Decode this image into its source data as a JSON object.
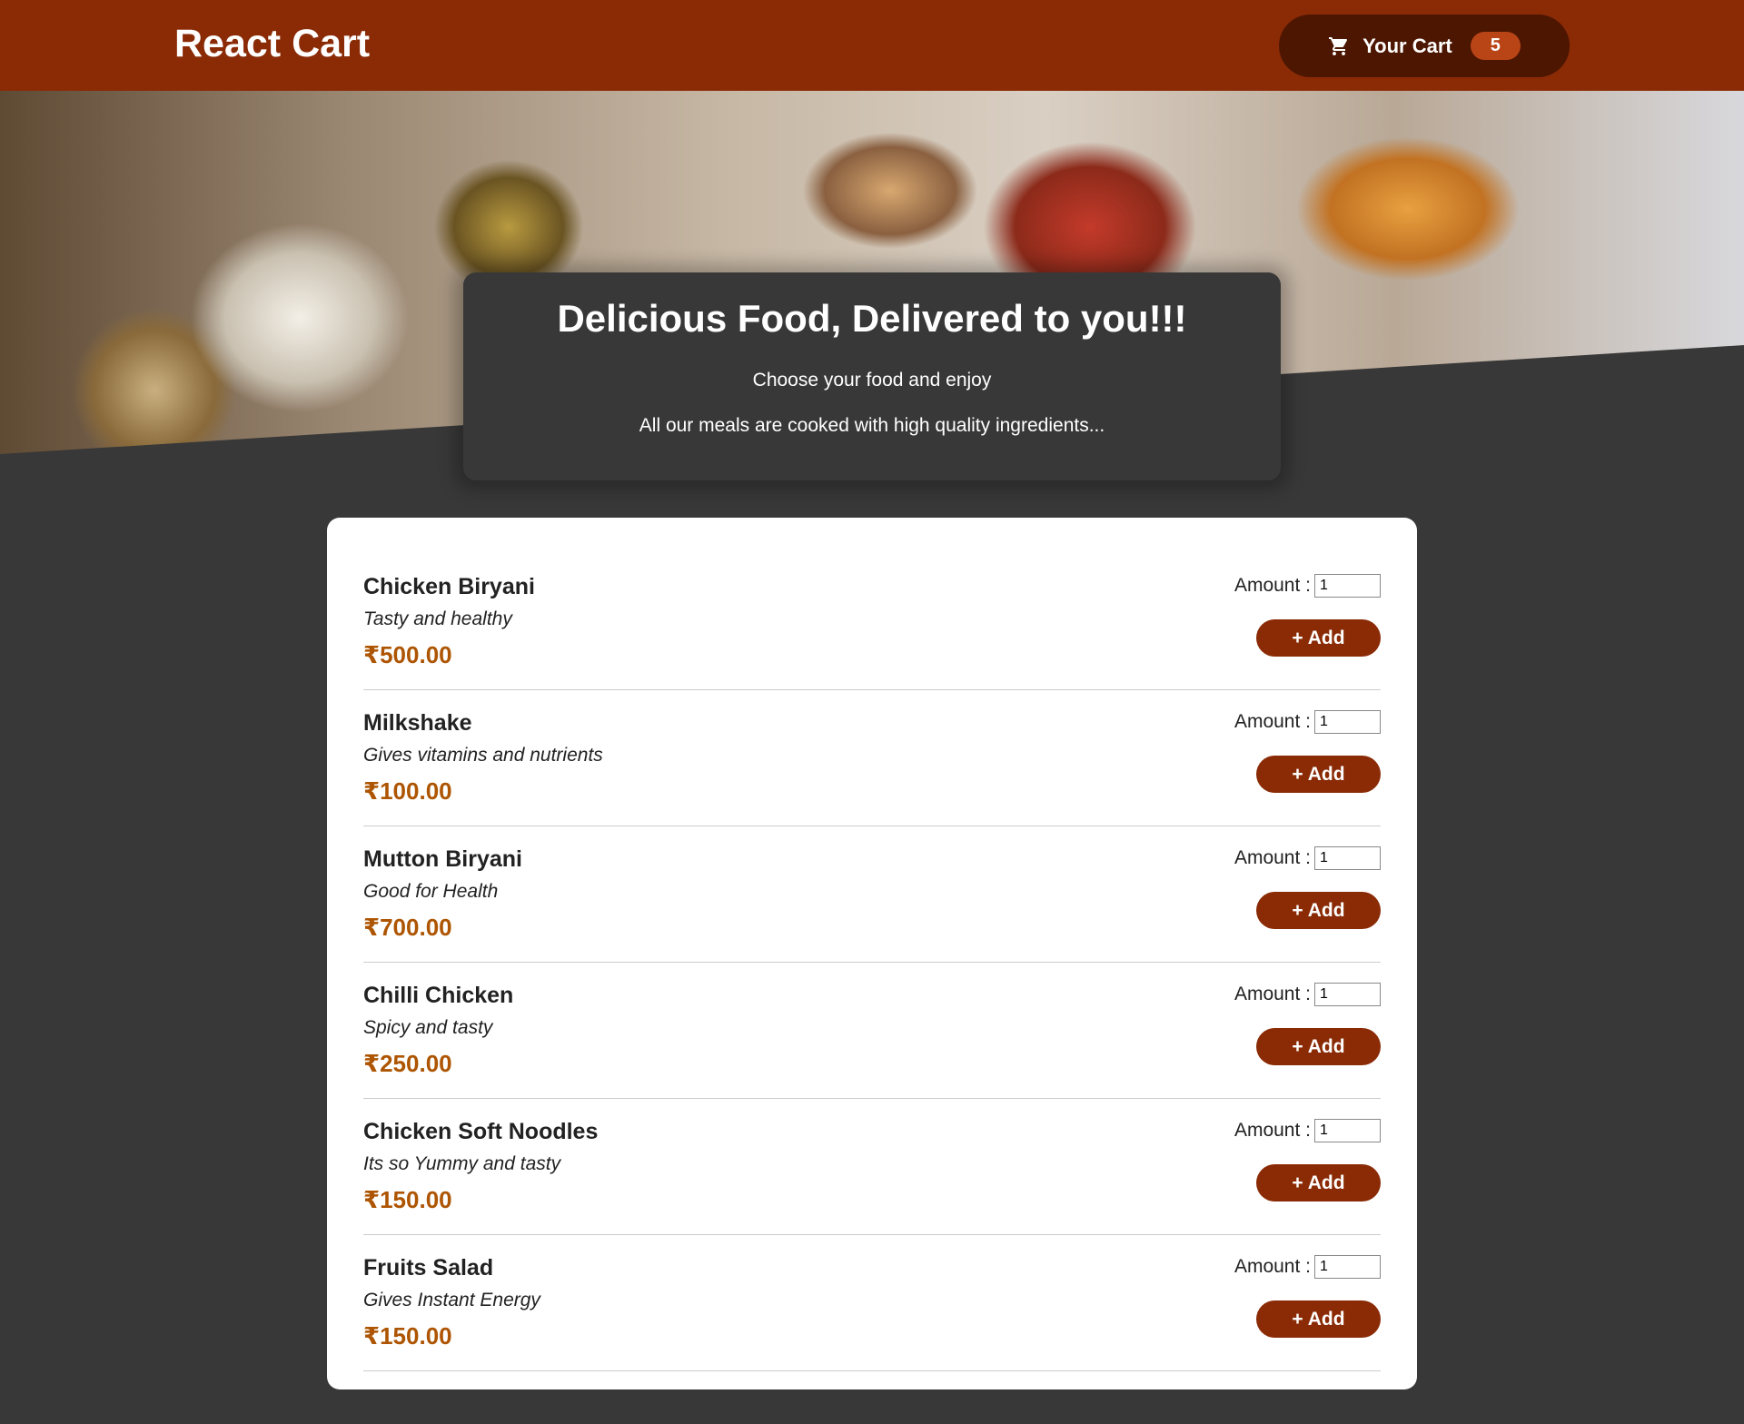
{
  "header": {
    "brand": "React Cart",
    "cart_label": "Your Cart",
    "cart_count": "5"
  },
  "hero": {
    "title": "Delicious Food, Delivered to you!!!",
    "line1": "Choose your food and enjoy",
    "line2": "All our meals are cooked with high quality ingredients..."
  },
  "meals": [
    {
      "name": "Chicken Biryani",
      "description": "Tasty and healthy",
      "price": "₹500.00",
      "amount_label": "Amount :",
      "amount_value": "1",
      "add_label": "+ Add"
    },
    {
      "name": "Milkshake",
      "description": "Gives vitamins and nutrients",
      "price": "₹100.00",
      "amount_label": "Amount :",
      "amount_value": "1",
      "add_label": "+ Add"
    },
    {
      "name": "Mutton Biryani",
      "description": "Good for Health",
      "price": "₹700.00",
      "amount_label": "Amount :",
      "amount_value": "1",
      "add_label": "+ Add"
    },
    {
      "name": "Chilli Chicken",
      "description": "Spicy and tasty",
      "price": "₹250.00",
      "amount_label": "Amount :",
      "amount_value": "1",
      "add_label": "+ Add"
    },
    {
      "name": "Chicken Soft Noodles",
      "description": "Its so Yummy and tasty",
      "price": "₹150.00",
      "amount_label": "Amount :",
      "amount_value": "1",
      "add_label": "+ Add"
    },
    {
      "name": "Fruits Salad",
      "description": "Gives Instant Energy",
      "price": "₹150.00",
      "amount_label": "Amount :",
      "amount_value": "1",
      "add_label": "+ Add"
    }
  ],
  "colors": {
    "header_bg": "#8a2b06",
    "cart_button_bg": "#4d1601",
    "cart_badge_bg": "#b94517",
    "page_bg": "#383838",
    "price": "#ad5502",
    "add_button_bg": "#8a2b06"
  },
  "icons": {
    "cart": "shopping-cart-icon",
    "hero_image": "food-buffet-photo"
  }
}
